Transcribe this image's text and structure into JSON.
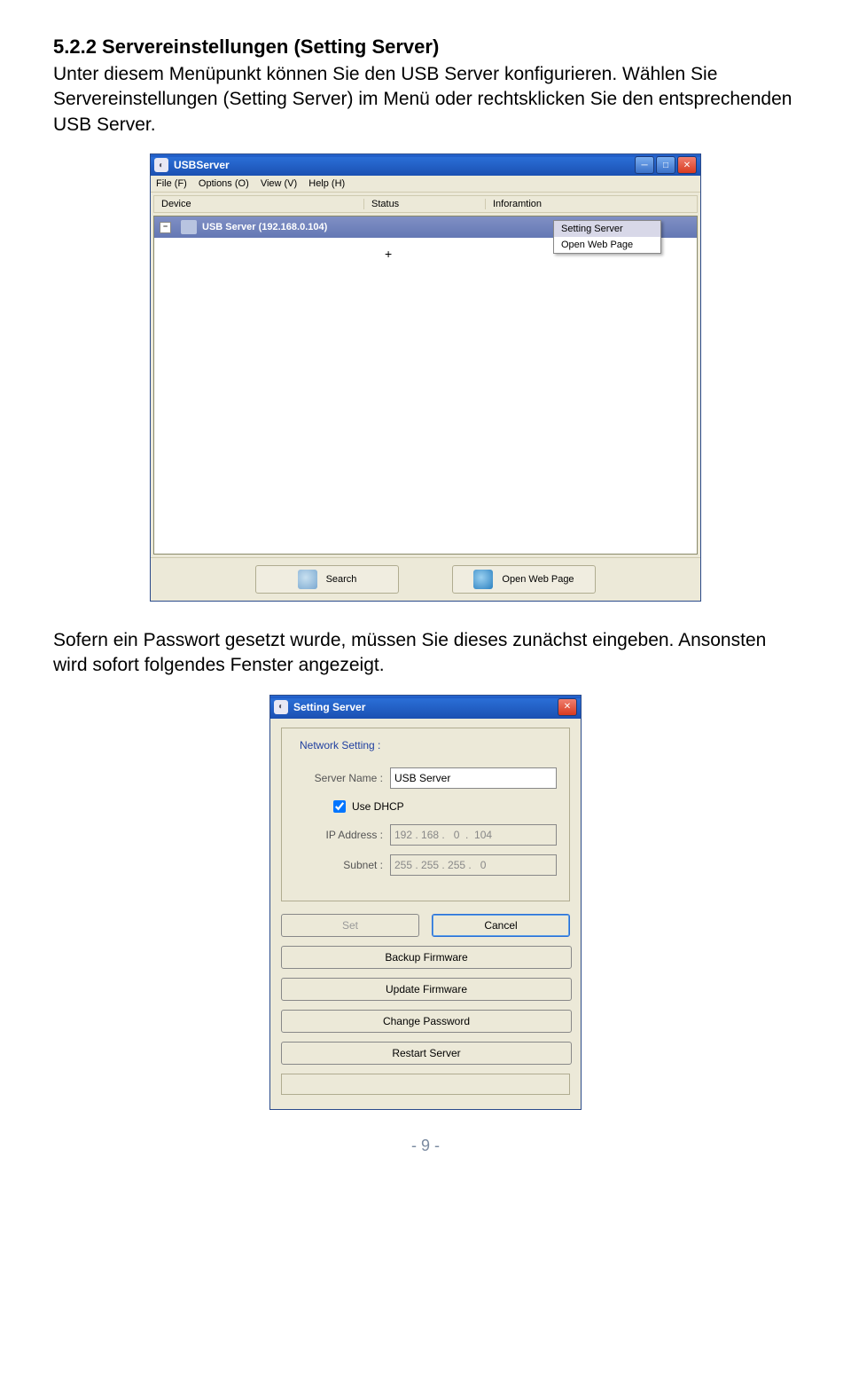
{
  "section": {
    "heading": "5.2.2 Servereinstellungen (Setting Server)",
    "para1": "Unter diesem Menüpunkt können Sie den USB Server konfigurieren. Wählen Sie Servereinstellungen (Setting Server) im Menü oder rechtsklicken Sie den entsprechenden USB Server.",
    "para2": "Sofern ein Passwort gesetzt wurde, müssen Sie dieses zunächst eingeben. Ansonsten wird sofort folgendes Fenster angezeigt."
  },
  "usbserver_window": {
    "title": "USBServer",
    "menu": {
      "file": "File (F)",
      "options": "Options (O)",
      "view": "View (V)",
      "help": "Help (H)"
    },
    "columns": {
      "device": "Device",
      "status": "Status",
      "info": "Inforamtion"
    },
    "server_row": "USB Server  (192.168.0.104)",
    "tree_toggle": "−",
    "context_menu": {
      "setting": "Setting Server",
      "open": "Open Web Page"
    },
    "buttons": {
      "search": "Search",
      "open_web": "Open Web Page"
    }
  },
  "setting_dialog": {
    "title": "Setting Server",
    "legend": "Network Setting :",
    "server_name_label": "Server Name :",
    "server_name_value": "USB Server",
    "dhcp_label": "Use DHCP",
    "dhcp_checked": true,
    "ip_label": "IP Address :",
    "ip_value": "192 . 168 .   0  .  104",
    "subnet_label": "Subnet :",
    "subnet_value": "255 . 255 . 255 .   0",
    "set_btn": "Set",
    "cancel_btn": "Cancel",
    "backup_btn": "Backup Firmware",
    "update_btn": "Update Firmware",
    "change_pw_btn": "Change Password",
    "restart_btn": "Restart Server"
  },
  "page_number": "- 9 -"
}
